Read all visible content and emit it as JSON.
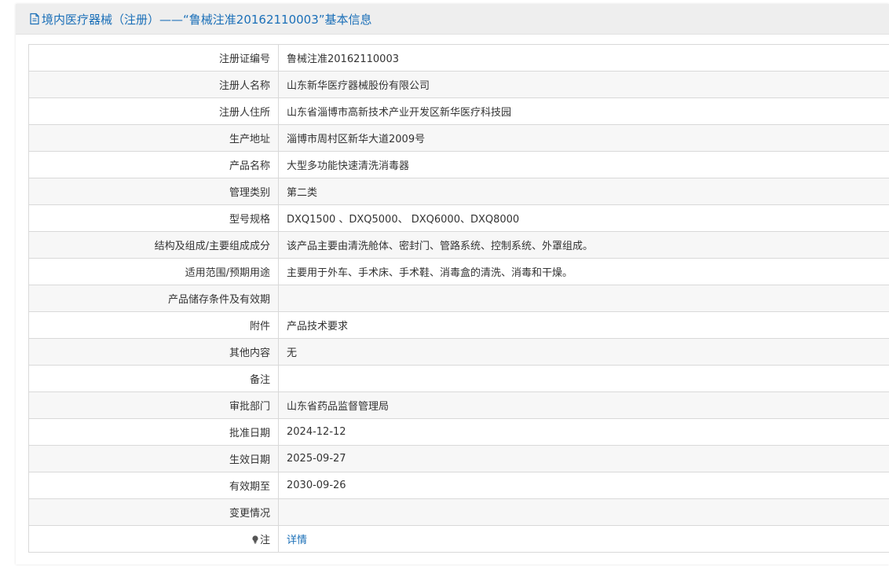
{
  "header": {
    "title": "境内医疗器械（注册）——“鲁械注准20162110003”基本信息",
    "icon": "document-icon"
  },
  "rows": [
    {
      "label": "注册证编号",
      "value": "鲁械注准20162110003"
    },
    {
      "label": "注册人名称",
      "value": "山东新华医疗器械股份有限公司"
    },
    {
      "label": "注册人住所",
      "value": "山东省淄博市高新技术产业开发区新华医疗科技园"
    },
    {
      "label": "生产地址",
      "value": "淄博市周村区新华大道2009号"
    },
    {
      "label": "产品名称",
      "value": "大型多功能快速清洗消毒器"
    },
    {
      "label": "管理类别",
      "value": "第二类"
    },
    {
      "label": "型号规格",
      "value": "DXQ1500 、DXQ5000、 DXQ6000、DXQ8000"
    },
    {
      "label": "结构及组成/主要组成成分",
      "value": "该产品主要由清洗舱体、密封门、管路系统、控制系统、外罩组成。"
    },
    {
      "label": "适用范围/预期用途",
      "value": "主要用于外车、手术床、手术鞋、消毒盒的清洗、消毒和干燥。"
    },
    {
      "label": "产品储存条件及有效期",
      "value": ""
    },
    {
      "label": "附件",
      "value": "产品技术要求"
    },
    {
      "label": "其他内容",
      "value": "无"
    },
    {
      "label": "备注",
      "value": ""
    },
    {
      "label": "审批部门",
      "value": "山东省药品监督管理局"
    },
    {
      "label": "批准日期",
      "value": "2024-12-12"
    },
    {
      "label": "生效日期",
      "value": "2025-09-27"
    },
    {
      "label": "有效期至",
      "value": "2030-09-26"
    },
    {
      "label": "变更情况",
      "value": ""
    }
  ],
  "note_row": {
    "label": "注",
    "icon": "lightbulb-icon",
    "link_text": "详情"
  },
  "colors": {
    "accent": "#1a6fb8",
    "header_bg": "#eeeeee",
    "row_alt": "#f7f7f7",
    "border": "#d9d9d9"
  }
}
